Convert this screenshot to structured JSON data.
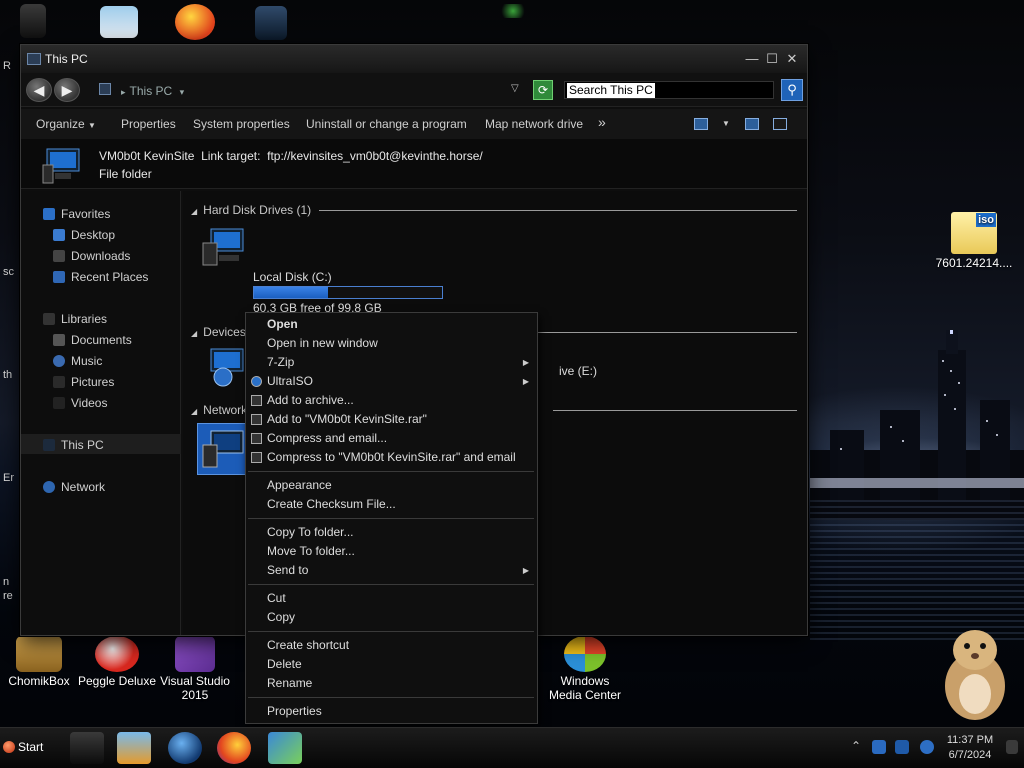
{
  "window": {
    "title": "This PC",
    "min_glyph": "—",
    "max_glyph": "☐",
    "close_glyph": "✕"
  },
  "address": {
    "back_glyph": "◀",
    "forward_glyph": "▶",
    "path": "This PC",
    "search_placeholder": "Search This PC",
    "search_glyph": "⚲",
    "refresh_glyph": "⟳",
    "dropdown_glyph": "▽"
  },
  "commands": {
    "organize": "Organize",
    "properties": "Properties",
    "system_properties": "System properties",
    "uninstall": "Uninstall or change a program",
    "map_drive": "Map network drive",
    "more": "»",
    "view_drop": "▼"
  },
  "details": {
    "name": "VM0b0t KevinSite",
    "link_label": "Link target:",
    "link_target": "ftp://kevinsites_vm0b0t@kevinthe.horse/",
    "kind": "File folder"
  },
  "nav": {
    "favorites": "Favorites",
    "desktop": "Desktop",
    "downloads": "Downloads",
    "recent": "Recent Places",
    "libraries": "Libraries",
    "documents": "Documents",
    "music": "Music",
    "pictures": "Pictures",
    "videos": "Videos",
    "this_pc": "This PC",
    "network": "Network"
  },
  "content": {
    "group_hdd": "Hard Disk Drives (1)",
    "group_removable": "Devices with Removable Storage (2)",
    "group_network": "Network",
    "local_disk_name": "Local Disk (C:)",
    "local_disk_free": "60.3 GB free of 99.8 GB",
    "local_disk_used_fraction": 0.396,
    "removable_e_partial": "ive (E:)",
    "collapse_glyph": "◢"
  },
  "context_menu": {
    "open": "Open",
    "open_new_window": "Open in new window",
    "seven_zip": "7-Zip",
    "ultraiso": "UltraISO",
    "add_archive": "Add to archive...",
    "add_rar": "Add to \"VM0b0t KevinSite.rar\"",
    "compress_email": "Compress and email...",
    "compress_rar_email": "Compress to \"VM0b0t KevinSite.rar\" and email",
    "appearance": "Appearance",
    "checksum": "Create Checksum File...",
    "copy_to": "Copy To folder...",
    "move_to": "Move To folder...",
    "send_to": "Send to",
    "cut": "Cut",
    "copy": "Copy",
    "create_shortcut": "Create shortcut",
    "delete": "Delete",
    "rename": "Rename",
    "properties": "Properties",
    "submenu_arrow": "▶"
  },
  "desktop": {
    "iso_label": "7601.24214....",
    "chomikbox": "ChomikBox",
    "peggle": "Peggle Deluxe",
    "vs_line1": "Visual Studio",
    "vs_line2": "2015",
    "wmc_line1": "Windows",
    "wmc_line2": "Media Center",
    "edge_r": "R",
    "edge_sc": "sc",
    "edge_th": "th",
    "edge_er": "Er",
    "edge_n": "n",
    "edge_re": "re"
  },
  "taskbar": {
    "start": "Start",
    "time": "11:37 PM",
    "date": "6/7/2024",
    "tray_arrow": "⌃"
  },
  "colors": {
    "accent_blue": "#1b5fc0",
    "window_bg": "#0e0e0e",
    "menu_bg": "#0f0f0f"
  }
}
